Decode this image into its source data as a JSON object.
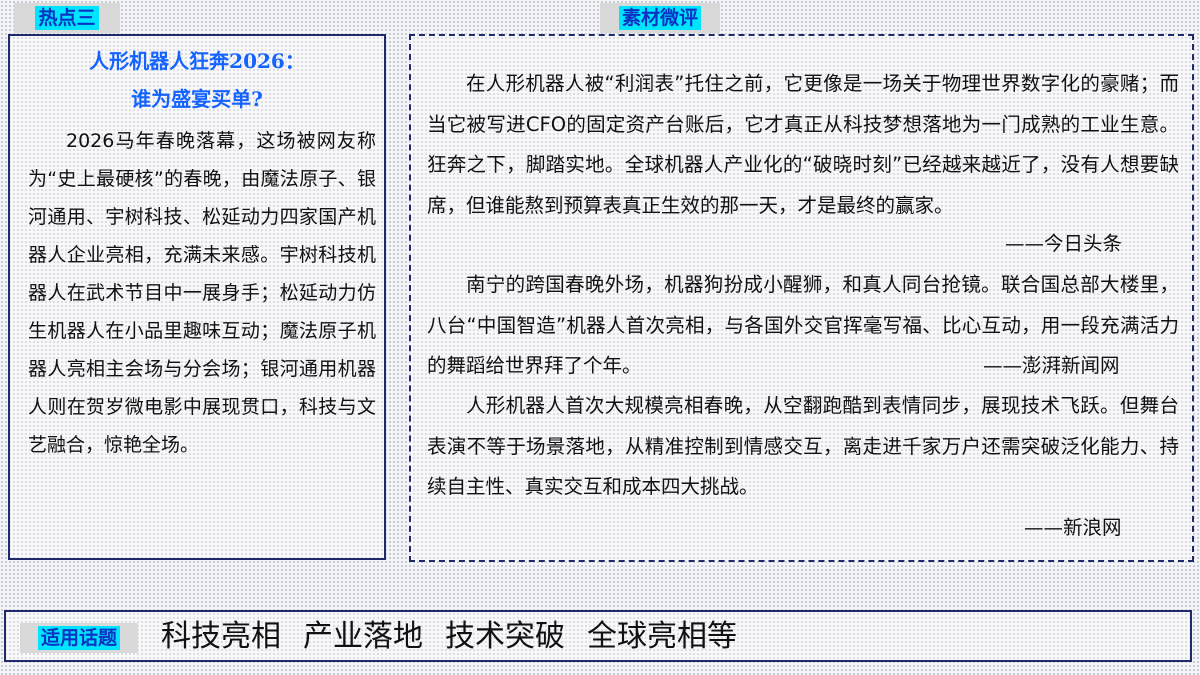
{
  "tags": {
    "hot": "热点三",
    "review": "素材微评",
    "topics": "适用话题"
  },
  "article": {
    "title_line1": "人形机器人狂奔2026：",
    "title_line2": "谁为盛宴买单?",
    "body": "2026马年春晚落幕，这场被网友称为“史上最硬核”的春晚，由魔法原子、银河通用、宇树科技、松延动力四家国产机器人企业亮相，充满未来感。宇树科技机器人在武术节目中一展身手；松延动力仿生机器人在小品里趣味互动；魔法原子机器人亮相主会场与分会场；银河通用机器人则在贺岁微电影中展现贯口，科技与文艺融合，惊艳全场。"
  },
  "reviews": [
    {
      "text": "在人形机器人被“利润表”托住之前，它更像是一场关于物理世界数字化的豪赌；而当它被写进CFO的固定资产台账后，它才真正从科技梦想落地为一门成熟的工业生意。狂奔之下，脚踏实地。全球机器人产业化的“破晓时刻”已经越来越近了，没有人想要缺席，但谁能熬到预算表真正生效的那一天，才是最终的赢家。",
      "source": "——今日头条"
    },
    {
      "text": "南宁的跨国春晚外场，机器狗扮成小醒狮，和真人同台抢镜。联合国总部大楼里，八台“中国智造”机器人首次亮相，与各国外交官挥毫写福、比心互动，用一段充满活力的舞蹈给世界拜了个年。",
      "source": "——澎湃新闻网"
    },
    {
      "text": "人形机器人首次大规模亮相春晚，从空翻跑酷到表情同步，展现技术飞跃。但舞台表演不等于场景落地，从精准控制到情感交互，离走进千家万户还需突破泛化能力、持续自主性、真实交互和成本四大挑战。",
      "source": "——新浪网"
    }
  ],
  "topics": [
    "科技亮相",
    "产业落地",
    "技术突破",
    "全球亮相等"
  ],
  "colors": {
    "tag_bg": "#00e5ff",
    "tag_text": "#0a33c4",
    "title_blue": "#1463ff",
    "border": "#1f2a6b"
  }
}
